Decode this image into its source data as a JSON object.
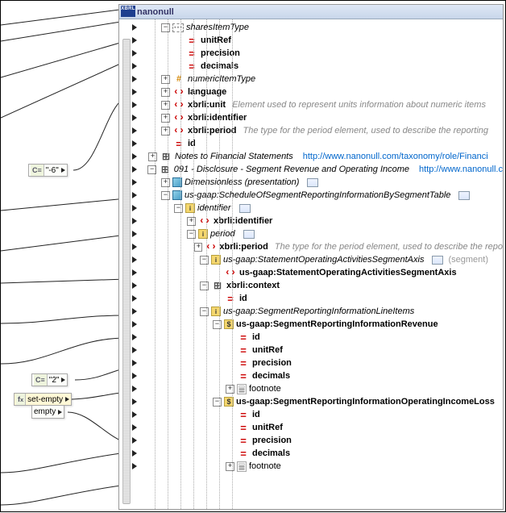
{
  "panel": {
    "title": "nanonull",
    "titleIconText": "XBRL"
  },
  "nodes": {
    "const_neg6": "\"-6\"",
    "const_2": "\"2\"",
    "fn_setempty": "set-empty",
    "fn_empty": "empty"
  },
  "tree": [
    {
      "depth": 1,
      "toggle": "-",
      "icon": "group",
      "label": "sharesItemType",
      "italic": true
    },
    {
      "depth": 2,
      "toggle": "",
      "icon": "attr",
      "label": "unitRef",
      "bold": true
    },
    {
      "depth": 2,
      "toggle": "",
      "icon": "attr",
      "label": "precision",
      "bold": true
    },
    {
      "depth": 2,
      "toggle": "",
      "icon": "attr",
      "label": "decimals",
      "bold": true
    },
    {
      "depth": 1,
      "toggle": "+",
      "icon": "hash",
      "label": "numericItemType",
      "italic": true
    },
    {
      "depth": 1,
      "toggle": "+",
      "icon": "element",
      "label": "language",
      "bold": true
    },
    {
      "depth": 1,
      "toggle": "+",
      "icon": "element",
      "label": "xbrli:unit",
      "bold": true,
      "desc": "Element used to represent units information about numeric items"
    },
    {
      "depth": 1,
      "toggle": "+",
      "icon": "element",
      "label": "xbrli:identifier",
      "bold": true
    },
    {
      "depth": 1,
      "toggle": "+",
      "icon": "element",
      "label": "xbrli:period",
      "bold": true,
      "desc": "The type for the period element, used to describe the reporting"
    },
    {
      "depth": 1,
      "toggle": "",
      "icon": "attr",
      "label": "id",
      "bold": true
    },
    {
      "depth": 0,
      "toggle": "+",
      "icon": "table",
      "label": "Notes to Financial Statements",
      "italic": true,
      "url": "http://www.nanonull.com/taxonomy/role/Financi"
    },
    {
      "depth": 0,
      "toggle": "-",
      "icon": "table",
      "label": "091 - Disclosure - Segment Revenue and Operating Income",
      "italic": true,
      "url": "http://www.nanonull.c"
    },
    {
      "depth": 1,
      "toggle": "+",
      "icon": "cube",
      "label": "Dimensionless (presentation)",
      "italic": true,
      "micro": true
    },
    {
      "depth": 1,
      "toggle": "-",
      "icon": "cube",
      "label": "us-gaap:ScheduleOfSegmentReportingInformationBySegmentTable",
      "italic": true,
      "micro": true
    },
    {
      "depth": 2,
      "toggle": "-",
      "icon": "id",
      "label": "identifier",
      "italic": true,
      "micro": true
    },
    {
      "depth": 3,
      "toggle": "+",
      "icon": "element",
      "label": "xbrli:identifier",
      "bold": true
    },
    {
      "depth": 3,
      "toggle": "-",
      "icon": "id",
      "label": "period",
      "italic": true,
      "micro": true
    },
    {
      "depth": 4,
      "toggle": "+",
      "icon": "element",
      "label": "xbrli:period",
      "bold": true,
      "desc": "The type for the period element, used to describe the repo"
    },
    {
      "depth": 4,
      "toggle": "-",
      "icon": "id",
      "label": "us-gaap:StatementOperatingActivitiesSegmentAxis",
      "italic": true,
      "micro": true,
      "segment": "(segment)"
    },
    {
      "depth": 5,
      "toggle": "",
      "icon": "element",
      "label": "us-gaap:StatementOperatingActivitiesSegmentAxis",
      "bold": true
    },
    {
      "depth": 4,
      "toggle": "-",
      "icon": "table",
      "label": "xbrli:context",
      "bold": true
    },
    {
      "depth": 5,
      "toggle": "",
      "icon": "attr",
      "label": "id",
      "bold": true
    },
    {
      "depth": 4,
      "toggle": "-",
      "icon": "id",
      "label": "us-gaap:SegmentReportingInformationLineItems",
      "italic": true
    },
    {
      "depth": 5,
      "toggle": "-",
      "icon": "dollar",
      "label": "us-gaap:SegmentReportingInformationRevenue",
      "bold": true
    },
    {
      "depth": 6,
      "toggle": "",
      "icon": "attr",
      "label": "id",
      "bold": true
    },
    {
      "depth": 6,
      "toggle": "",
      "icon": "attr",
      "label": "unitRef",
      "bold": true
    },
    {
      "depth": 6,
      "toggle": "",
      "icon": "attr",
      "label": "precision",
      "bold": true
    },
    {
      "depth": 6,
      "toggle": "",
      "icon": "attr",
      "label": "decimals",
      "bold": true
    },
    {
      "depth": 6,
      "toggle": "+",
      "icon": "page",
      "label": "footnote"
    },
    {
      "depth": 5,
      "toggle": "-",
      "icon": "dollar",
      "label": "us-gaap:SegmentReportingInformationOperatingIncomeLoss",
      "bold": true
    },
    {
      "depth": 6,
      "toggle": "",
      "icon": "attr",
      "label": "id",
      "bold": true
    },
    {
      "depth": 6,
      "toggle": "",
      "icon": "attr",
      "label": "unitRef",
      "bold": true
    },
    {
      "depth": 6,
      "toggle": "",
      "icon": "attr",
      "label": "precision",
      "bold": true
    },
    {
      "depth": 6,
      "toggle": "",
      "icon": "attr",
      "label": "decimals",
      "bold": true
    },
    {
      "depth": 6,
      "toggle": "+",
      "icon": "page",
      "label": "footnote"
    }
  ]
}
